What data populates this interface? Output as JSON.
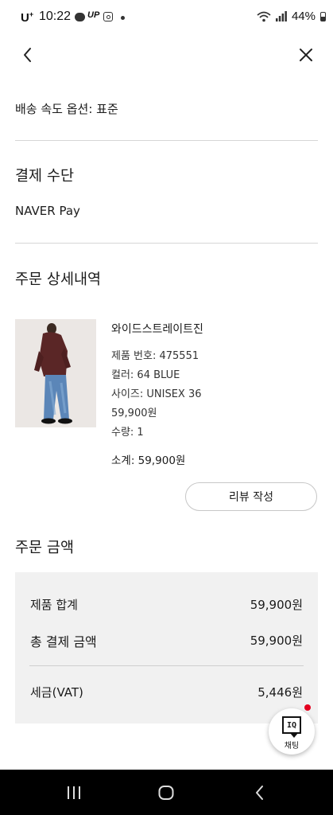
{
  "status_bar": {
    "carrier": "U",
    "carrier_sup": "+",
    "time": "10:22",
    "app_label": "UP",
    "battery": "44%"
  },
  "header": {
    "back_icon": "chevron-left-icon",
    "close_icon": "close-icon"
  },
  "delivery": {
    "speed_option": "배송 속도 옵션: 표준"
  },
  "payment": {
    "title": "결제 수단",
    "method": "NAVER Pay"
  },
  "order_details": {
    "title": "주문 상세내역",
    "product": {
      "name": "와이드스트레이트진",
      "product_number": "제품 번호: 475551",
      "color": "컬러: 64 BLUE",
      "size": "사이즈: UNISEX 36",
      "price": "59,900원",
      "quantity": "수량: 1",
      "subtotal": "소계: 59,900원"
    },
    "review_button": "리뷰 작성"
  },
  "order_amount": {
    "title": "주문 금액",
    "rows": [
      {
        "label": "제품 합계",
        "value": "59,900원"
      },
      {
        "label": "총 결제 금액",
        "value": "59,900원"
      },
      {
        "label": "세금(VAT)",
        "value": "5,446원"
      }
    ]
  },
  "chat_button": {
    "icon_text": "IQ",
    "label": "채팅"
  },
  "nav_bar": {
    "recent_icon": "recent-apps-icon",
    "home_icon": "home-icon",
    "back_icon": "back-icon"
  }
}
